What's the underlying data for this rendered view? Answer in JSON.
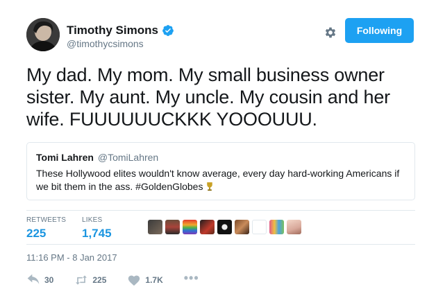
{
  "author": {
    "name": "Timothy Simons",
    "handle": "@timothycsimons",
    "verified": true
  },
  "header": {
    "follow_label": "Following"
  },
  "tweet": {
    "text": "My dad.  My mom.  My small business owner sister.  My aunt.  My uncle.  My cousin and her wife.  FUUUUUUCKKK YOOOUUU."
  },
  "quoted": {
    "name": "Tomi Lahren",
    "handle": "@TomiLahren",
    "text": "These Hollywood elites wouldn't know average, every day hard-working Americans if we bit them in the ass. #GoldenGlobes"
  },
  "stats": {
    "retweets_label": "RETWEETS",
    "retweets_value": "225",
    "likes_label": "LIKES",
    "likes_value": "1,745"
  },
  "timestamp": "11:16 PM - 8 Jan 2017",
  "actions": {
    "reply_count": "30",
    "retweet_count": "225",
    "like_count": "1.7K",
    "more_label": "•••"
  },
  "colors": {
    "accent": "#1da1f2",
    "link": "#1b95e0",
    "muted": "#657786",
    "border": "#e1e8ed"
  },
  "icons": [
    "verified-badge-icon",
    "gear-icon",
    "reply-icon",
    "retweet-icon",
    "heart-icon",
    "more-icon",
    "trophy-icon"
  ]
}
